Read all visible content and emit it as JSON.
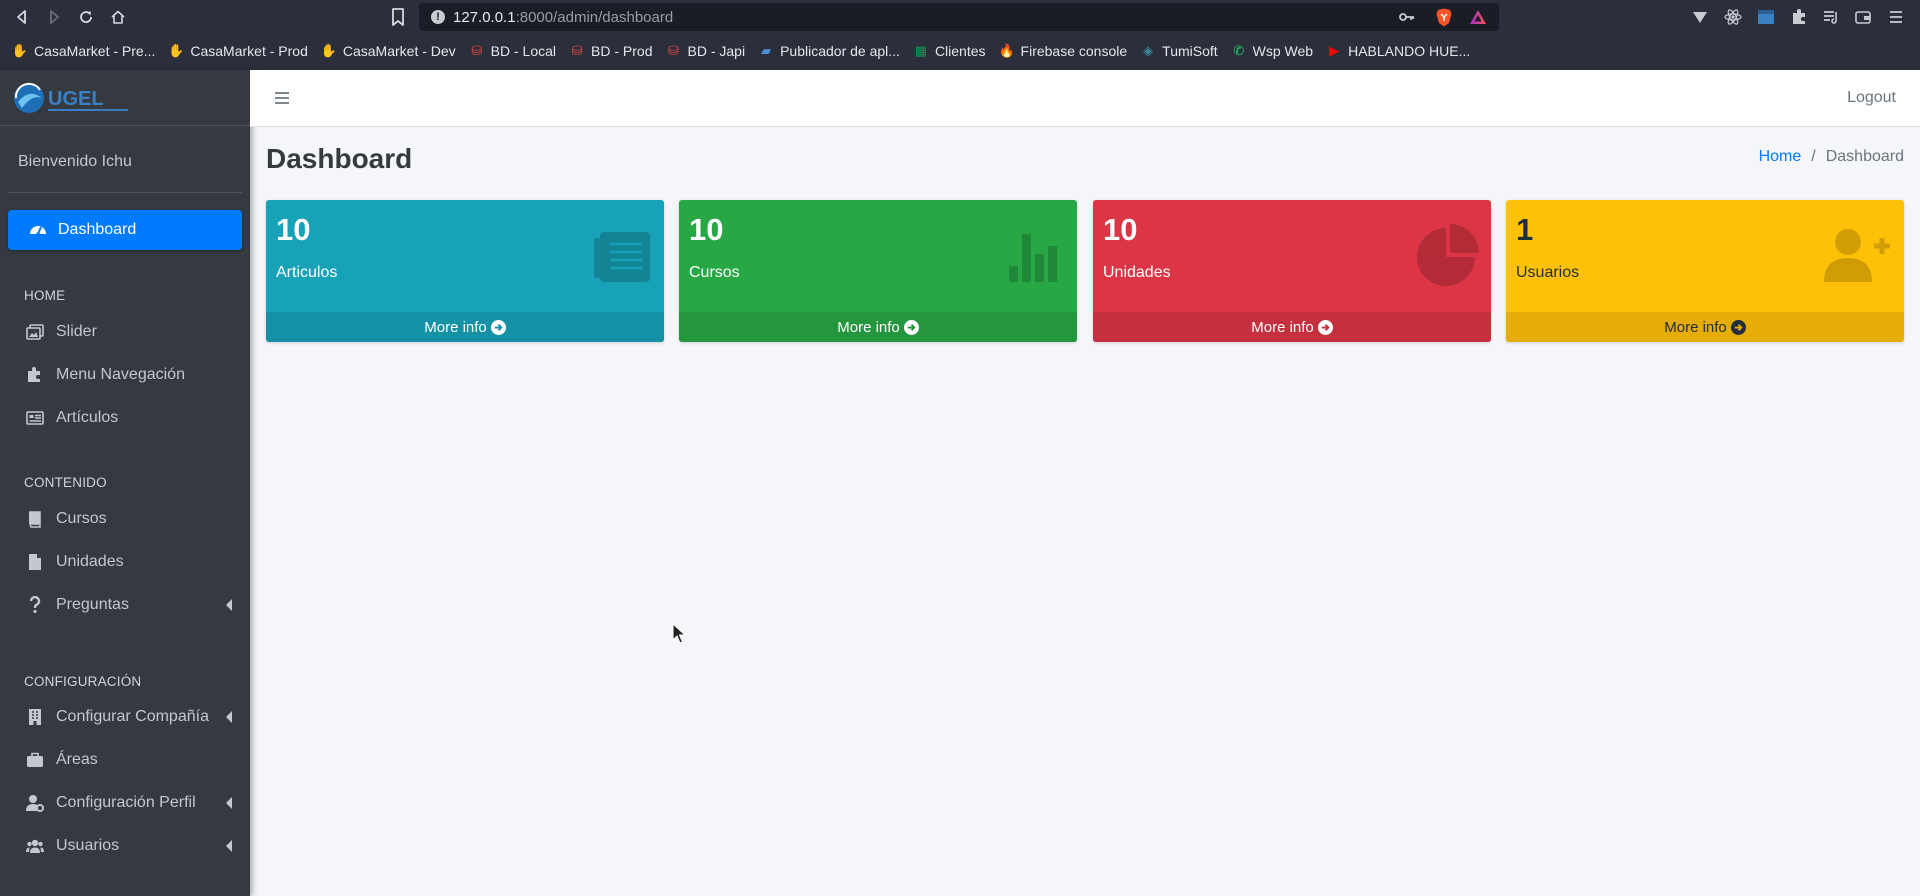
{
  "browser": {
    "url_host": "127.0.0.1",
    "url_rest": ":8000/admin/dashboard",
    "bookmarks": [
      {
        "label": "CasaMarket - Pre...",
        "icon": "hand-icon",
        "color": "#9acd32"
      },
      {
        "label": "CasaMarket - Prod",
        "icon": "hand-icon",
        "color": "#9acd32"
      },
      {
        "label": "CasaMarket - Dev",
        "icon": "hand-icon",
        "color": "#9acd32"
      },
      {
        "label": "BD - Local",
        "icon": "database-icon",
        "color": "#e74c3c"
      },
      {
        "label": "BD - Prod",
        "icon": "database-icon",
        "color": "#e74c3c"
      },
      {
        "label": "BD - Japi",
        "icon": "database-icon",
        "color": "#e74c3c"
      },
      {
        "label": "Publicador de apl...",
        "icon": "publisher-icon",
        "color": "#4a90d9"
      },
      {
        "label": "Clientes",
        "icon": "sheets-icon",
        "color": "#0f9d58"
      },
      {
        "label": "Firebase console",
        "icon": "firebase-icon",
        "color": "#ffa000"
      },
      {
        "label": "TumiSoft",
        "icon": "tumisoft-icon",
        "color": "#3b8ea5"
      },
      {
        "label": "Wsp Web",
        "icon": "whatsapp-icon",
        "color": "#25d366"
      },
      {
        "label": "HABLANDO HUE...",
        "icon": "youtube-icon",
        "color": "#ff0000"
      }
    ]
  },
  "sidebar": {
    "brand": "UGEL",
    "welcome": "Bienvenido Ichu",
    "active_item": "Dashboard",
    "sections": [
      {
        "header": "HOME",
        "items": [
          {
            "label": "Slider",
            "icon": "images-icon",
            "has_children": false
          },
          {
            "label": "Menu Navegación",
            "icon": "puzzle-icon",
            "has_children": false
          },
          {
            "label": "Artículos",
            "icon": "newspaper-icon",
            "has_children": false
          }
        ]
      },
      {
        "header": "CONTENIDO",
        "items": [
          {
            "label": "Cursos",
            "icon": "book-icon",
            "has_children": false
          },
          {
            "label": "Unidades",
            "icon": "file-icon",
            "has_children": false
          },
          {
            "label": "Preguntas",
            "icon": "question-icon",
            "has_children": true
          }
        ]
      },
      {
        "header": "CONFIGURACIÓN",
        "items": [
          {
            "label": "Configurar Compañía",
            "icon": "building-icon",
            "has_children": true
          },
          {
            "label": "Áreas",
            "icon": "briefcase-icon",
            "has_children": false
          },
          {
            "label": "Configuración Perfil",
            "icon": "user-cog-icon",
            "has_children": true
          },
          {
            "label": "Usuarios",
            "icon": "users-icon",
            "has_children": true
          }
        ]
      }
    ]
  },
  "topbar": {
    "logout": "Logout"
  },
  "content": {
    "title": "Dashboard",
    "breadcrumb": [
      {
        "label": "Home",
        "link": true
      },
      {
        "label": "Dashboard",
        "link": false
      }
    ],
    "boxes": [
      {
        "value": "10",
        "label": "Articulos",
        "footer": "More info",
        "icon": "newspaper-icon",
        "color": "#17a2b8"
      },
      {
        "value": "10",
        "label": "Cursos",
        "footer": "More info",
        "icon": "bar-chart-icon",
        "color": "#28a745"
      },
      {
        "value": "10",
        "label": "Unidades",
        "footer": "More info",
        "icon": "pie-chart-icon",
        "color": "#dc3545"
      },
      {
        "value": "1",
        "label": "Usuarios",
        "footer": "More info",
        "icon": "user-plus-icon",
        "color": "#ffc107"
      }
    ]
  }
}
